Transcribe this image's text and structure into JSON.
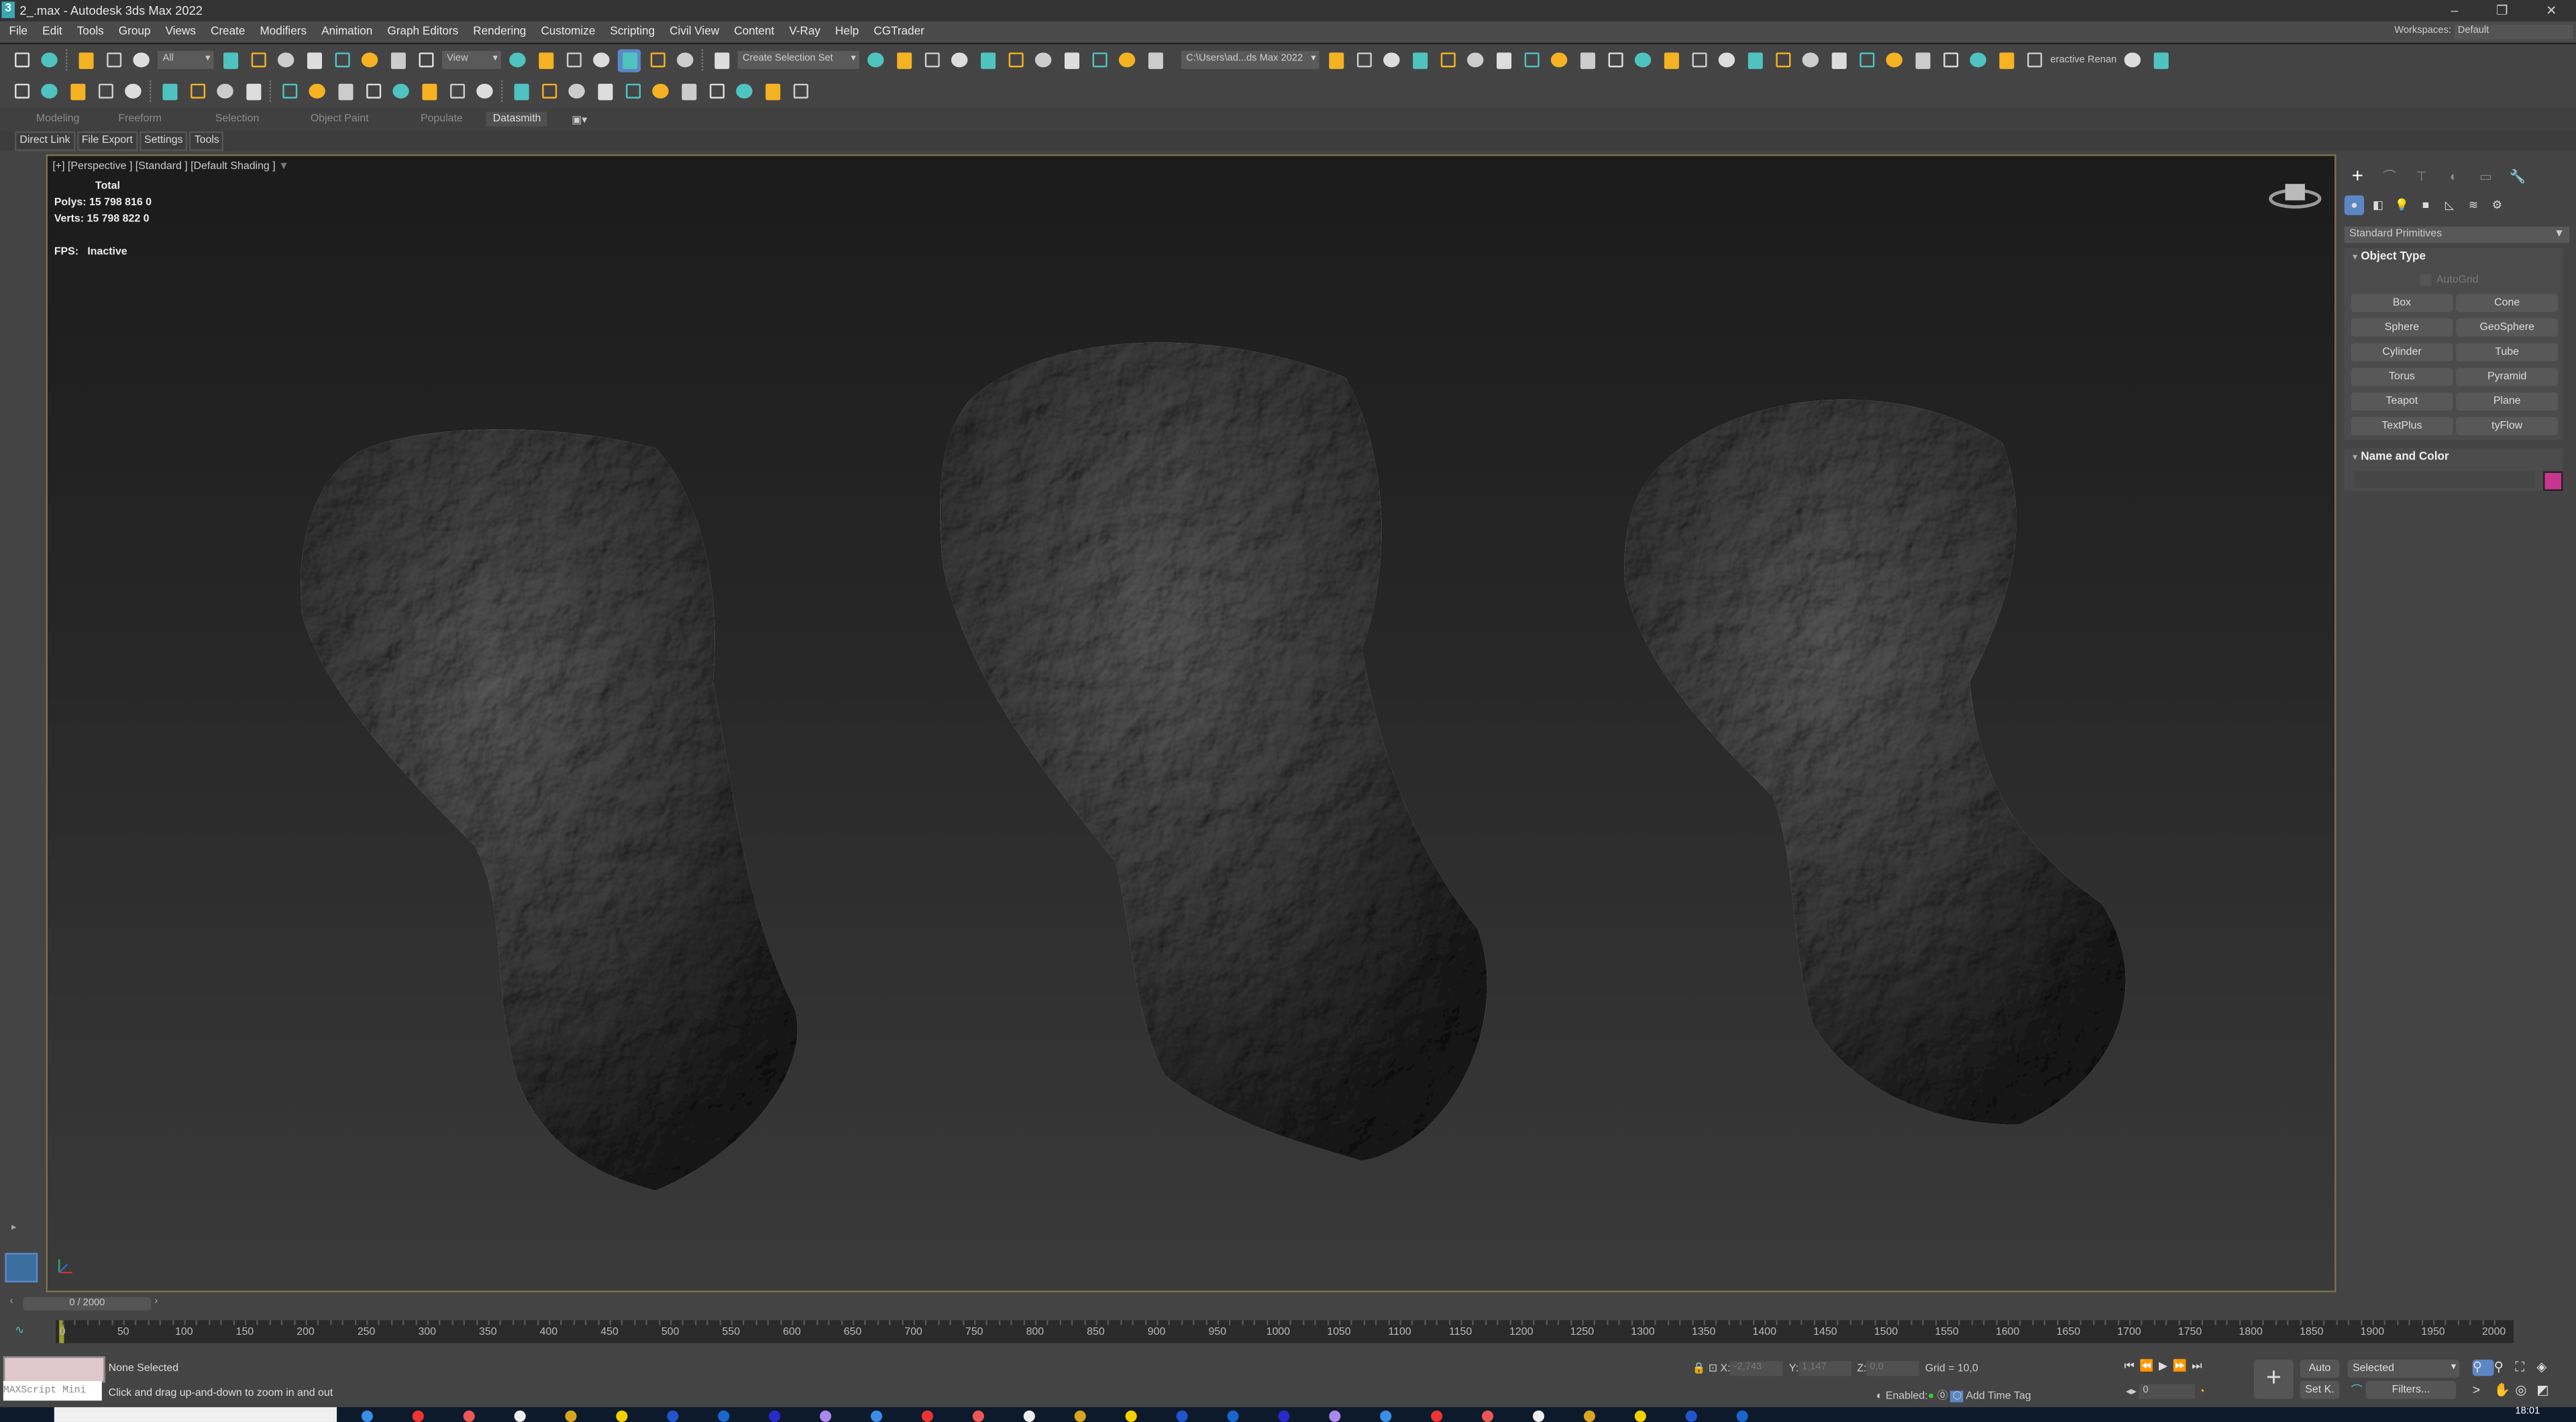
{
  "window": {
    "title": "2_.max - Autodesk 3ds Max 2022",
    "app_icon": "3"
  },
  "menu": [
    "File",
    "Edit",
    "Tools",
    "Group",
    "Views",
    "Create",
    "Modifiers",
    "Animation",
    "Graph Editors",
    "Rendering",
    "Customize",
    "Scripting",
    "Civil View",
    "Content",
    "V-Ray",
    "Help",
    "CGTrader"
  ],
  "workspaces": {
    "label": "Workspaces:",
    "value": "Default"
  },
  "toolbar": {
    "selection_filter": "All",
    "ref_coord": "View",
    "selection_set": "Create Selection Set",
    "project_path": "C:\\Users\\ad...ds Max 2022",
    "interactive_label": "eractive Renan",
    "row1_icons": [
      "undo-icon",
      "redo-icon",
      "link-icon",
      "unlink-icon",
      "bind-space-warp-icon",
      "select-object-icon",
      "select-by-name-icon",
      "rect-region-icon",
      "window-crossing-icon",
      "move-icon",
      "rotate-icon",
      "scale-icon",
      "place-icon",
      "use-pivot-icon",
      "select-manipulate-icon",
      "keyboard-shortcut-icon",
      "snaps-2-5-icon",
      "angle-snap-icon",
      "percent-snap-icon",
      "spinner-snap-icon",
      "edit-named-sets-icon"
    ],
    "row1b_icons": [
      "mirror-icon",
      "align-icon",
      "toggle-scene-explorer-icon",
      "toggle-layer-explorer-icon",
      "curve-editor-icon",
      "schematic-view-icon",
      "material-editor-icon",
      "render-setup-icon",
      "rendered-frame-icon",
      "render-production-icon",
      "render-iterative-icon"
    ],
    "row1c_icons": [
      "project-folder-icon",
      "open-folder-icon",
      "asset-tracking-icon",
      "xref-icon",
      "vray-camera-icon",
      "vray-physical-camera-icon",
      "vray-light-icon",
      "vray-sun-icon",
      "vray-fur-icon",
      "vray-proxy-icon",
      "vray-frame-buffer-icon",
      "vray-tree-icon",
      "vray-material-icon",
      "vray-vfb-icon",
      "vray-lister-icon",
      "vray-ies-icon",
      "render-window-icon",
      "render-active-icon",
      "render-region-icon",
      "vray-teapot-icon",
      "vray-clipper-icon",
      "vray-import-icon",
      "vray-help-icon",
      "forest-icon",
      "forest-list-icon",
      "forest-help-icon",
      "checkmark-icon",
      "corona-icon"
    ],
    "row2_icons": [
      "arc-rotate-icon",
      "orbit-icon",
      "isolate-icon",
      "freeze-icon",
      "hide-icon",
      "teapot-icon",
      "sphere-create-icon",
      "box-create-icon",
      "list-icon",
      "camera-icon",
      "target-spot-icon",
      "omni-icon",
      "sky-icon",
      "spotlight-icon",
      "vray-light-bulb-icon",
      "sun-icon",
      "ies-sun-icon",
      "box-wire-icon",
      "sphere-shaded-icon",
      "helper-icon",
      "tree-disabled-icon",
      "grass-disabled-icon",
      "fire-icon",
      "gray-sphere-icon",
      "material-balls-icon",
      "paint-icon",
      "bake-icon",
      "render-elements-icon"
    ]
  },
  "ribbon": {
    "tabs": [
      "Modeling",
      "Freeform",
      "Selection",
      "Object Paint",
      "Populate",
      "Datasmith"
    ],
    "active": "Datasmith",
    "subtabs": [
      "Direct Link",
      "File Export",
      "Settings",
      "Tools"
    ]
  },
  "viewport": {
    "label": "[+] [Perspective ] [Standard ] [Default Shading ]",
    "stats": {
      "header": "Total",
      "polys_label": "Polys:",
      "polys": "15 798 816 0",
      "verts_label": "Verts:",
      "verts": "15 798 822 0",
      "fps_label": "FPS:",
      "fps": "Inactive"
    }
  },
  "command_panel": {
    "tabs": [
      "create-icon",
      "modify-icon",
      "hierarchy-icon",
      "motion-icon",
      "display-icon",
      "utilities-icon"
    ],
    "subtabs": [
      "geometry-icon",
      "shapes-icon",
      "lights-icon",
      "cameras-icon",
      "helpers-icon",
      "space-warps-icon",
      "systems-icon"
    ],
    "category": "Standard Primitives",
    "object_type": {
      "title": "Object Type",
      "autogrid": "AutoGrid",
      "buttons": [
        "Box",
        "Cone",
        "Sphere",
        "GeoSphere",
        "Cylinder",
        "Tube",
        "Torus",
        "Pyramid",
        "Teapot",
        "Plane",
        "TextPlus",
        "tyFlow"
      ]
    },
    "name_color": {
      "title": "Name and Color",
      "color": "#c8358f"
    }
  },
  "timeline": {
    "frame": "0 / 2000",
    "labels": [
      "0",
      "50",
      "100",
      "150",
      "200",
      "250",
      "300",
      "350",
      "400",
      "450",
      "500",
      "550",
      "600",
      "650",
      "700",
      "750",
      "800",
      "850",
      "900",
      "950",
      "1000",
      "1050",
      "1100",
      "1150",
      "1200",
      "1250",
      "1300",
      "1350",
      "1400",
      "1450",
      "1500",
      "1550",
      "1600",
      "1650",
      "1700",
      "1750",
      "1800",
      "1850",
      "1900",
      "1950",
      "2000"
    ]
  },
  "status": {
    "selection": "None Selected",
    "prompt": "Click and drag up-and-down to zoom in and out",
    "maxscript": "MAXScript Mini",
    "x_label": "X:",
    "x": "-2,743",
    "y_label": "Y:",
    "y": "1,147",
    "z_label": "Z:",
    "z": "0,0",
    "grid": "Grid = 10,0",
    "enabled": "Enabled:",
    "time_tag": "Add Time Tag",
    "auto": "Auto",
    "setkey": "Set K.",
    "key_filter": "Selected",
    "filters": "Filters...",
    "current_frame": "0"
  },
  "taskbar": {
    "clock": "18:01"
  },
  "colors": {
    "accent": "#5b87c5",
    "viewport_border": "#77724a",
    "teal": "#4fc3c0",
    "orange": "#f5b222"
  }
}
